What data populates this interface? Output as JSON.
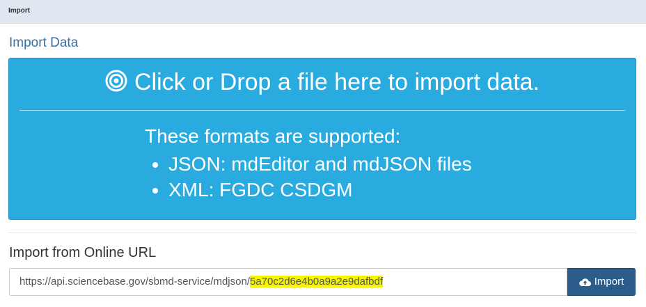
{
  "header": {
    "title": "Import"
  },
  "import_data": {
    "title": "Import Data",
    "dropzone": {
      "icon": "target-icon",
      "heading": "Click or Drop a file here to import data.",
      "formats_title": "These formats are supported:",
      "formats": [
        "JSON: mdEditor and mdJSON files",
        "XML: FGDC CSDGM"
      ]
    }
  },
  "online_url": {
    "label": "Import from Online URL",
    "url_prefix": "https://api.sciencebase.gov/sbmd-service/mdjson/",
    "url_highlighted": "5a70c2d6e4b0a9a2e9dafbdf",
    "highlight_color": "#f5f500",
    "import_button": {
      "label": "Import",
      "icon": "cloud-upload-icon"
    }
  },
  "colors": {
    "dropzone_bg": "#29abe0",
    "button_bg": "#2c5d8a",
    "header_bg": "#dfe8f0"
  }
}
